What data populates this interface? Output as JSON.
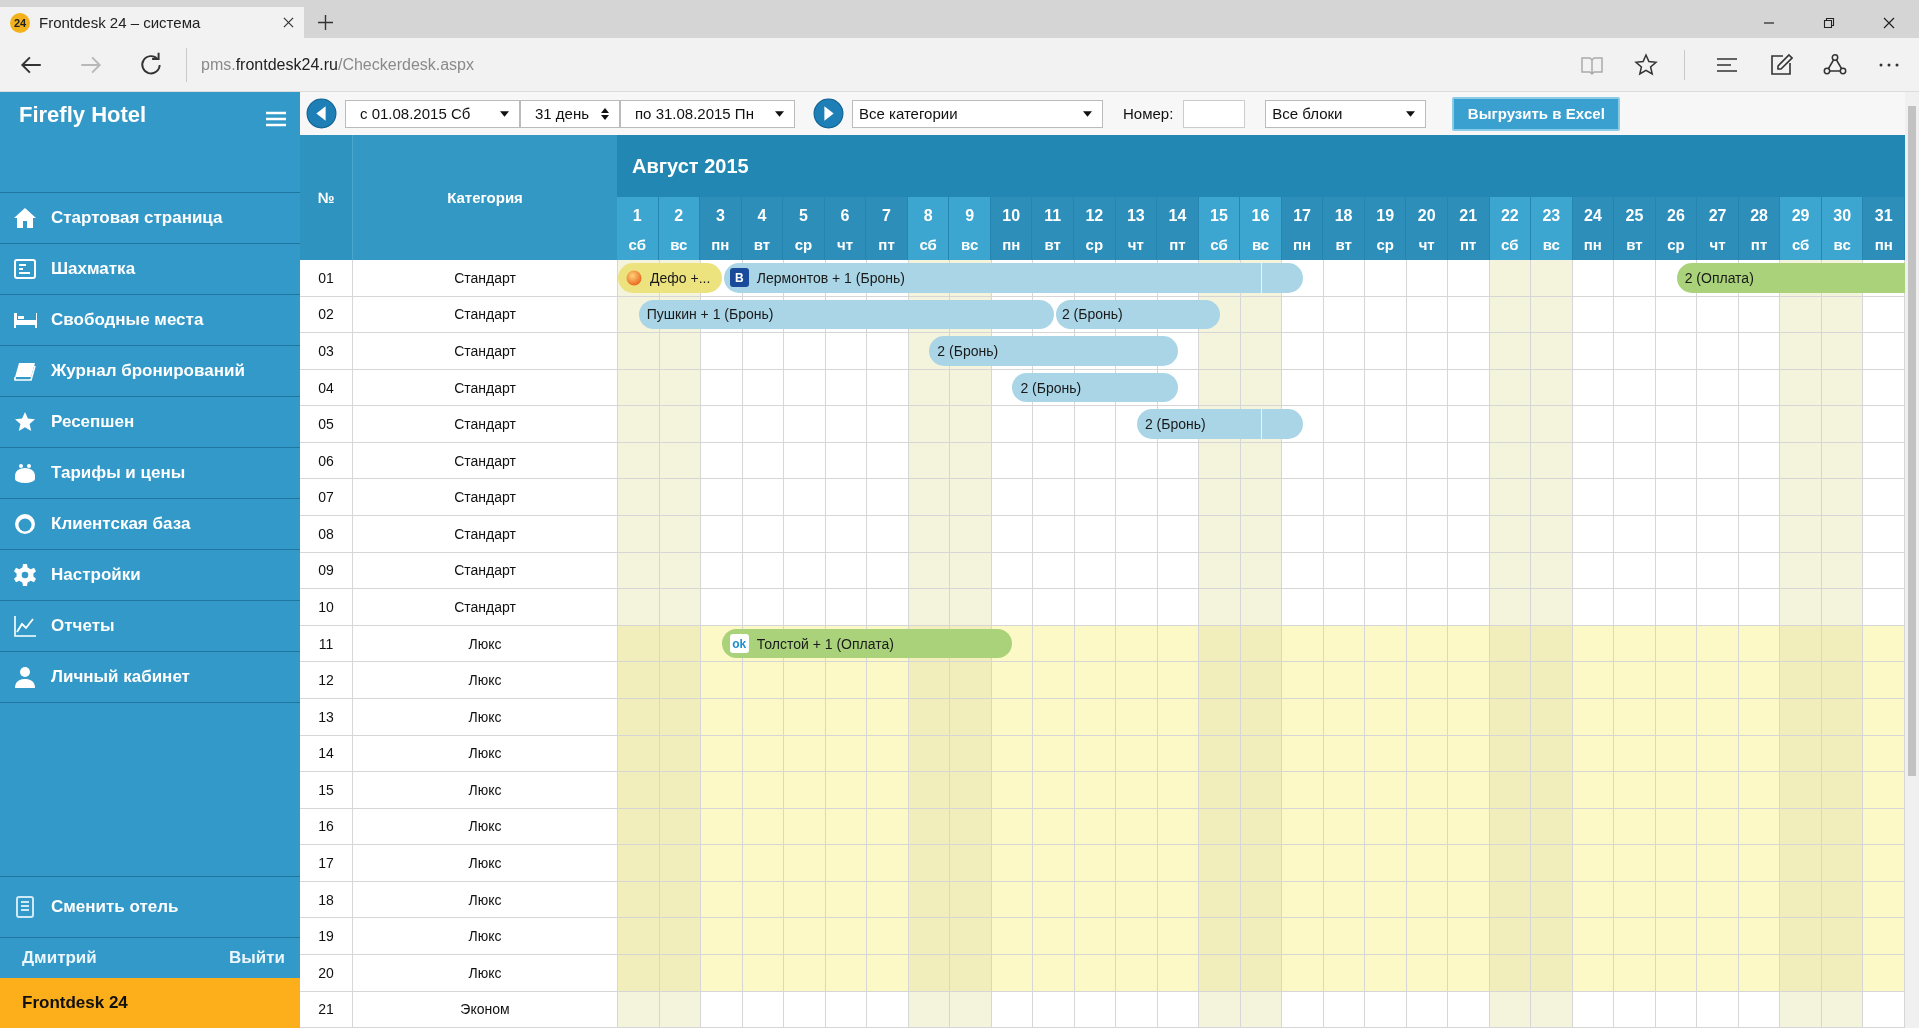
{
  "browser": {
    "tab": {
      "favicon": "24",
      "title": "Frontdesk 24 – система"
    },
    "forward": {
      "disabled": true
    },
    "address": {
      "prefix": "pms.",
      "host": "frontdesk24.ru",
      "path": "/Checkerdesk.aspx"
    },
    "reading_view": {
      "disabled": true
    }
  },
  "sidebar": {
    "title": "Firefly Hotel",
    "items": [
      "Стартовая страница",
      "Шахматка",
      "Свободные места",
      "Журнал бронирований",
      "Ресепшен",
      "Тарифы и цены",
      "Клиентская база",
      "Настройки",
      "Отчеты",
      "Личный кабинет"
    ],
    "switch_hotel": "Сменить отель",
    "user": "Дмитрий",
    "logout": "Выйти",
    "footer": "Frontdesk 24"
  },
  "toolbar": {
    "from": "с 01.08.2015 Сб",
    "duration": "31 день",
    "to": "по 31.08.2015 Пн",
    "category": "Все категории",
    "room_label": "Номер:",
    "blocks": "Все блоки",
    "export": "Выгрузить в Excel"
  },
  "grid": {
    "number_header": "№",
    "category_header": "Категория",
    "month": "Август 2015",
    "days": [
      {
        "day": "1",
        "weekday": "сб",
        "weekend": true
      },
      {
        "day": "2",
        "weekday": "вс",
        "weekend": true
      },
      {
        "day": "3",
        "weekday": "пн",
        "weekend": false
      },
      {
        "day": "4",
        "weekday": "вт",
        "weekend": false
      },
      {
        "day": "5",
        "weekday": "ср",
        "weekend": false
      },
      {
        "day": "6",
        "weekday": "чт",
        "weekend": false
      },
      {
        "day": "7",
        "weekday": "пт",
        "weekend": false
      },
      {
        "day": "8",
        "weekday": "сб",
        "weekend": true
      },
      {
        "day": "9",
        "weekday": "вс",
        "weekend": true
      },
      {
        "day": "10",
        "weekday": "пн",
        "weekend": false
      },
      {
        "day": "11",
        "weekday": "вт",
        "weekend": false
      },
      {
        "day": "12",
        "weekday": "ср",
        "weekend": false
      },
      {
        "day": "13",
        "weekday": "чт",
        "weekend": false
      },
      {
        "day": "14",
        "weekday": "пт",
        "weekend": false
      },
      {
        "day": "15",
        "weekday": "сб",
        "weekend": true
      },
      {
        "day": "16",
        "weekday": "вс",
        "weekend": true
      },
      {
        "day": "17",
        "weekday": "пн",
        "weekend": false
      },
      {
        "day": "18",
        "weekday": "вт",
        "weekend": false
      },
      {
        "day": "19",
        "weekday": "ср",
        "weekend": false
      },
      {
        "day": "20",
        "weekday": "чт",
        "weekend": false
      },
      {
        "day": "21",
        "weekday": "пт",
        "weekend": false
      },
      {
        "day": "22",
        "weekday": "сб",
        "weekend": true
      },
      {
        "day": "23",
        "weekday": "вс",
        "weekend": true
      },
      {
        "day": "24",
        "weekday": "пн",
        "weekend": false
      },
      {
        "day": "25",
        "weekday": "вт",
        "weekend": false
      },
      {
        "day": "26",
        "weekday": "ср",
        "weekend": false
      },
      {
        "day": "27",
        "weekday": "чт",
        "weekend": false
      },
      {
        "day": "28",
        "weekday": "пт",
        "weekend": false
      },
      {
        "day": "29",
        "weekday": "сб",
        "weekend": true
      },
      {
        "day": "30",
        "weekday": "вс",
        "weekend": true
      },
      {
        "day": "31",
        "weekday": "пн",
        "weekend": false
      }
    ],
    "rows": [
      {
        "number": "01",
        "category": "Стандарт",
        "highlighted": false,
        "earlier_booking": {
          "label": "Дефо +...",
          "kind": "pending",
          "icon": {
            "kind": "ball"
          }
        },
        "nights": [
          {
            "booked": true
          },
          {
            "booked": true
          },
          {
            "booked": true,
            "booking": {
              "label": "Лермонтов + 1 (Бронь)",
              "kind": "reserved",
              "icon": {
                "kind": "dark-letter",
                "text": "B"
              }
            }
          },
          {
            "booked": true
          },
          {
            "booked": true
          },
          {
            "booked": true
          },
          {
            "booked": true
          },
          {
            "booked": true
          },
          {
            "booked": true
          },
          {
            "booked": true
          },
          {
            "booked": true
          },
          {
            "booked": true
          },
          {
            "booked": true
          },
          {
            "booked": true
          },
          {
            "booked": true
          },
          {
            "booked": true
          },
          {
            "booked": false
          },
          {
            "booked": false
          },
          {
            "booked": false
          },
          {
            "booked": false
          },
          {
            "booked": false
          },
          {
            "booked": false
          },
          {
            "booked": false
          },
          {
            "booked": false
          },
          {
            "booked": false
          },
          {
            "booked": true,
            "booking": {
              "label": "2 (Оплата)",
              "kind": "paid"
            }
          },
          {
            "booked": true
          },
          {
            "booked": true
          },
          {
            "booked": true
          },
          {
            "booked": true
          },
          {
            "booked": true
          }
        ]
      },
      {
        "number": "02",
        "category": "Стандарт",
        "highlighted": false,
        "nights": [
          {
            "booked": true,
            "booking": {
              "label": "Пушкин + 1 (Бронь)",
              "kind": "reserved"
            }
          },
          {
            "booked": true
          },
          {
            "booked": true
          },
          {
            "booked": true
          },
          {
            "booked": true
          },
          {
            "booked": true
          },
          {
            "booked": true
          },
          {
            "booked": true
          },
          {
            "booked": true
          },
          {
            "booked": true
          },
          {
            "booked": true,
            "booking": {
              "label": "2 (Бронь)",
              "kind": "reserved"
            }
          },
          {
            "booked": true
          },
          {
            "booked": true
          },
          {
            "booked": true
          },
          {
            "booked": false
          },
          {
            "booked": false
          },
          {
            "booked": false
          },
          {
            "booked": false
          },
          {
            "booked": false
          },
          {
            "booked": false
          },
          {
            "booked": false
          },
          {
            "booked": false
          },
          {
            "booked": false
          },
          {
            "booked": false
          },
          {
            "booked": false
          },
          {
            "booked": false
          },
          {
            "booked": false
          },
          {
            "booked": false
          },
          {
            "booked": false
          },
          {
            "booked": false
          },
          {
            "booked": false
          }
        ]
      },
      {
        "number": "03",
        "category": "Стандарт",
        "highlighted": false,
        "nights": [
          {
            "booked": false
          },
          {
            "booked": false
          },
          {
            "booked": false
          },
          {
            "booked": false
          },
          {
            "booked": false
          },
          {
            "booked": false
          },
          {
            "booked": false
          },
          {
            "booked": true,
            "booking": {
              "label": "2 (Бронь)",
              "kind": "reserved"
            }
          },
          {
            "booked": true
          },
          {
            "booked": true
          },
          {
            "booked": true
          },
          {
            "booked": true
          },
          {
            "booked": true
          },
          {
            "booked": false
          },
          {
            "booked": false
          },
          {
            "booked": false
          },
          {
            "booked": false
          },
          {
            "booked": false
          },
          {
            "booked": false
          },
          {
            "booked": false
          },
          {
            "booked": false
          },
          {
            "booked": false
          },
          {
            "booked": false
          },
          {
            "booked": false
          },
          {
            "booked": false
          },
          {
            "booked": false
          },
          {
            "booked": false
          },
          {
            "booked": false
          },
          {
            "booked": false
          },
          {
            "booked": false
          },
          {
            "booked": false
          }
        ]
      },
      {
        "number": "04",
        "category": "Стандарт",
        "highlighted": false,
        "nights": [
          {
            "booked": false
          },
          {
            "booked": false
          },
          {
            "booked": false
          },
          {
            "booked": false
          },
          {
            "booked": false
          },
          {
            "booked": false
          },
          {
            "booked": false
          },
          {
            "booked": false
          },
          {
            "booked": false
          },
          {
            "booked": true,
            "booking": {
              "label": "2 (Бронь)",
              "kind": "reserved"
            }
          },
          {
            "booked": true
          },
          {
            "booked": true
          },
          {
            "booked": true
          },
          {
            "booked": false
          },
          {
            "booked": false
          },
          {
            "booked": false
          },
          {
            "booked": false
          },
          {
            "booked": false
          },
          {
            "booked": false
          },
          {
            "booked": false
          },
          {
            "booked": false
          },
          {
            "booked": false
          },
          {
            "booked": false
          },
          {
            "booked": false
          },
          {
            "booked": false
          },
          {
            "booked": false
          },
          {
            "booked": false
          },
          {
            "booked": false
          },
          {
            "booked": false
          },
          {
            "booked": false
          },
          {
            "booked": false
          }
        ]
      },
      {
        "number": "05",
        "category": "Стандарт",
        "highlighted": false,
        "nights": [
          {
            "booked": false
          },
          {
            "booked": false
          },
          {
            "booked": false
          },
          {
            "booked": false
          },
          {
            "booked": false
          },
          {
            "booked": false
          },
          {
            "booked": false
          },
          {
            "booked": false
          },
          {
            "booked": false
          },
          {
            "booked": false
          },
          {
            "booked": false
          },
          {
            "booked": false
          },
          {
            "booked": true,
            "booking": {
              "label": "2 (Бронь)",
              "kind": "reserved"
            }
          },
          {
            "booked": true
          },
          {
            "booked": true
          },
          {
            "booked": true
          },
          {
            "booked": false
          },
          {
            "booked": false
          },
          {
            "booked": false
          },
          {
            "booked": false
          },
          {
            "booked": false
          },
          {
            "booked": false
          },
          {
            "booked": false
          },
          {
            "booked": false
          },
          {
            "booked": false
          },
          {
            "booked": false
          },
          {
            "booked": false
          },
          {
            "booked": false
          },
          {
            "booked": false
          },
          {
            "booked": false
          },
          {
            "booked": false
          }
        ]
      },
      {
        "number": "06",
        "category": "Стандарт",
        "highlighted": false
      },
      {
        "number": "07",
        "category": "Стандарт",
        "highlighted": false
      },
      {
        "number": "08",
        "category": "Стандарт",
        "highlighted": false
      },
      {
        "number": "09",
        "category": "Стандарт",
        "highlighted": false
      },
      {
        "number": "10",
        "category": "Стандарт",
        "highlighted": false
      },
      {
        "number": "11",
        "category": "Люкс",
        "highlighted": true,
        "nights": [
          {
            "booked": false
          },
          {
            "booked": false
          },
          {
            "booked": true,
            "booking": {
              "label": "Толстой + 1 (Оплата)",
              "kind": "paid",
              "icon": {
                "kind": "light-letter",
                "text": "ok"
              }
            }
          },
          {
            "booked": true
          },
          {
            "booked": true
          },
          {
            "booked": true
          },
          {
            "booked": true
          },
          {
            "booked": true
          },
          {
            "booked": true
          },
          {
            "booked": false
          },
          {
            "booked": false
          },
          {
            "booked": false
          },
          {
            "booked": false
          },
          {
            "booked": false
          },
          {
            "booked": false
          },
          {
            "booked": false
          },
          {
            "booked": false
          },
          {
            "booked": false
          },
          {
            "booked": false
          },
          {
            "booked": false
          },
          {
            "booked": false
          },
          {
            "booked": false
          },
          {
            "booked": false
          },
          {
            "booked": false
          },
          {
            "booked": false
          },
          {
            "booked": false
          },
          {
            "booked": false
          },
          {
            "booked": false
          },
          {
            "booked": false
          },
          {
            "booked": false
          },
          {
            "booked": false
          }
        ]
      },
      {
        "number": "12",
        "category": "Люкс",
        "highlighted": true
      },
      {
        "number": "13",
        "category": "Люкс",
        "highlighted": true
      },
      {
        "number": "14",
        "category": "Люкс",
        "highlighted": true
      },
      {
        "number": "15",
        "category": "Люкс",
        "highlighted": true
      },
      {
        "number": "16",
        "category": "Люкс",
        "highlighted": true
      },
      {
        "number": "17",
        "category": "Люкс",
        "highlighted": true
      },
      {
        "number": "18",
        "category": "Люкс",
        "highlighted": true
      },
      {
        "number": "19",
        "category": "Люкс",
        "highlighted": true
      },
      {
        "number": "20",
        "category": "Люкс",
        "highlighted": true
      },
      {
        "number": "21",
        "category": "Эконом",
        "highlighted": false
      }
    ]
  }
}
